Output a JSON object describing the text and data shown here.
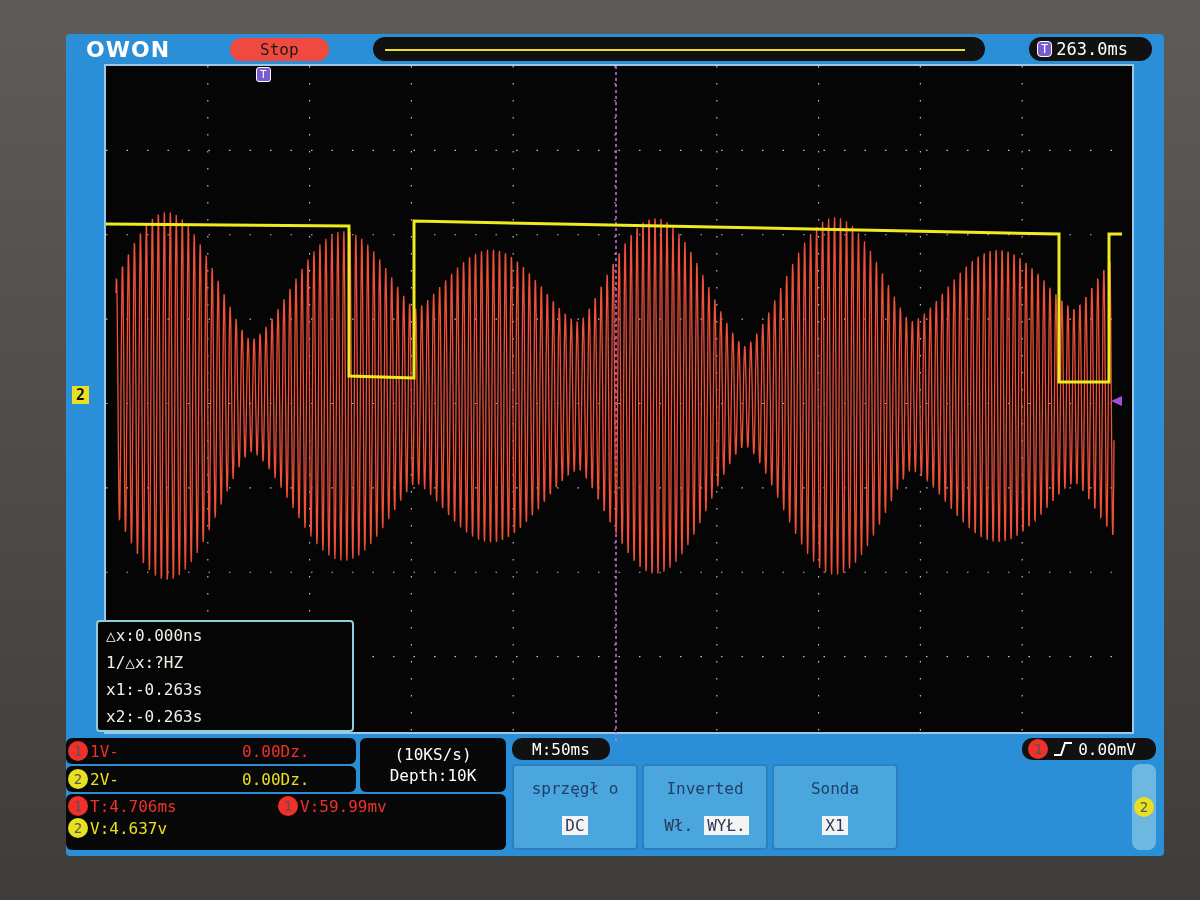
{
  "header": {
    "logo": "OWON",
    "run_state": "Stop",
    "time_badge": "T",
    "trigger_time": "263.0ms",
    "trigger_badge": "T"
  },
  "plot": {
    "channel_marker": "2"
  },
  "cursors": [
    "△x:0.000ns",
    "1/△x:?HZ",
    "x1:-0.263s",
    "x2:-0.263s"
  ],
  "channels": [
    {
      "badge": "1",
      "label": "1V-",
      "value": "0.00Dz.",
      "color": "#f0302a"
    },
    {
      "badge": "2",
      "label": "2V-",
      "value": "0.00Dz.",
      "color": "#e8e020"
    }
  ],
  "acquisition": {
    "rate": "(10KS/s)",
    "depth": "Depth:10K"
  },
  "measurements": [
    {
      "badge": "1",
      "text": "T:4.706ms",
      "color": "#f0302a"
    },
    {
      "badge": "1",
      "text": "V:59.99mv",
      "color": "#f0302a"
    },
    {
      "badge": "2",
      "text": "V:4.637v",
      "color": "#e8e020"
    }
  ],
  "timebase": "M:50ms",
  "trigger": {
    "badge": "1",
    "color": "#f0302a",
    "reading": "0.00mV"
  },
  "menu": [
    {
      "title": "sprzęgł o",
      "options": [
        {
          "label": "DC",
          "selected": true
        }
      ]
    },
    {
      "title": "Inverted",
      "options": [
        {
          "label": "Wł.",
          "selected": false
        },
        {
          "label": "WYŁ.",
          "selected": true
        }
      ]
    },
    {
      "title": "Sonda",
      "options": [
        {
          "label": "X1",
          "selected": true
        }
      ]
    }
  ],
  "side_tab": "2"
}
